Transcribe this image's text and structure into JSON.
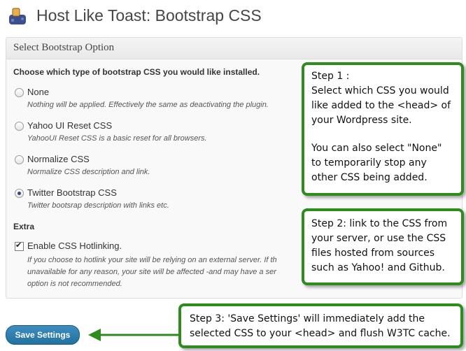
{
  "header": {
    "title": "Host Like Toast: Bootstrap CSS",
    "logo_icon": "toaster-icon"
  },
  "panel": {
    "title": "Select Bootstrap Option",
    "question": "Choose which type of bootstrap CSS you would like installed.",
    "options": [
      {
        "label": "None",
        "description": "Nothing will be applied. Effectively the same as deactivating the plugin.",
        "checked": false
      },
      {
        "label": "Yahoo UI Reset CSS",
        "description": "YahooUI Reset CSS is a basic reset for all browsers.",
        "checked": false
      },
      {
        "label": "Normalize CSS",
        "description": "Normalize CSS description and link.",
        "checked": false
      },
      {
        "label": "Twitter Bootstrap CSS",
        "description": "Twitter bootsrap description with links etc.",
        "checked": true
      }
    ],
    "extra": {
      "heading": "Extra",
      "hotlink_label": "Enable CSS Hotlinking.",
      "hotlink_checked": true,
      "hotlink_description_1": "If you choose to hotlink your site will be relying on an external server. If th",
      "hotlink_description_2": "unavailable for any reason, your site will be affected -and may have a ser",
      "hotlink_description_3": "option is not recommended."
    }
  },
  "save_button": {
    "label": "Save Settings"
  },
  "callouts": {
    "step1": {
      "l1": "Step 1 :",
      "l2": "Select which CSS you would",
      "l3": "like added to the <head> of",
      "l4": "your Wordpress site.",
      "l5": "You can also select \"None\"",
      "l6": "to temporarily stop any",
      "l7": "other CSS being added."
    },
    "step2": {
      "l1": "Step 2: link to the CSS from",
      "l2": "your server, or use the CSS",
      "l3": "files hosted from sources",
      "l4": "such as Yahoo! and Github."
    },
    "step3": {
      "l1": "Step 3: 'Save Settings' will immediately add the",
      "l2": "selected CSS to your <head> and flush W3TC cache."
    }
  },
  "colors": {
    "callout_border": "#2e8b1e",
    "button": "#21729f"
  }
}
